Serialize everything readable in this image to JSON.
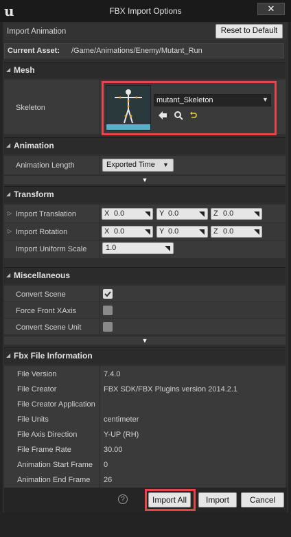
{
  "window": {
    "title": "FBX Import Options",
    "close_glyph": "✕",
    "logo_glyph": "u"
  },
  "header": {
    "import_animation_label": "Import Animation",
    "reset_label": "Reset to Default"
  },
  "asset": {
    "label": "Current Asset:",
    "path": "/Game/Animations/Enemy/Mutant_Run"
  },
  "mesh": {
    "section": "Mesh",
    "skeleton_label": "Skeleton",
    "skeleton_value": "mutant_Skeleton",
    "icons": [
      "arrow-left-icon",
      "magnifier-icon",
      "reset-arrow-icon"
    ]
  },
  "animation": {
    "section": "Animation",
    "length_label": "Animation Length",
    "length_value": "Exported Time"
  },
  "transform": {
    "section": "Transform",
    "translation_label": "Import Translation",
    "rotation_label": "Import Rotation",
    "scale_label": "Import Uniform Scale",
    "translation": {
      "x": "0.0",
      "y": "0.0",
      "z": "0.0"
    },
    "rotation": {
      "x": "0.0",
      "y": "0.0",
      "z": "0.0"
    },
    "axis_x": "X",
    "axis_y": "Y",
    "axis_z": "Z",
    "scale": "1.0"
  },
  "misc": {
    "section": "Miscellaneous",
    "convert_scene": "Convert Scene",
    "force_front": "Force Front XAxis",
    "convert_unit": "Convert Scene Unit",
    "convert_scene_checked": true,
    "force_front_checked": false,
    "convert_unit_checked": false
  },
  "info": {
    "section": "Fbx File Information",
    "rows": [
      {
        "label": "File Version",
        "value": "7.4.0"
      },
      {
        "label": "File Creator",
        "value": "FBX SDK/FBX Plugins version 2014.2.1"
      },
      {
        "label": "File Creator Application",
        "value": ""
      },
      {
        "label": "File Units",
        "value": "centimeter"
      },
      {
        "label": "File Axis Direction",
        "value": "Y-UP (RH)"
      },
      {
        "label": "File Frame Rate",
        "value": "30.00"
      },
      {
        "label": "Animation Start Frame",
        "value": "0"
      },
      {
        "label": "Animation End Frame",
        "value": "26"
      }
    ]
  },
  "footer": {
    "help": "?",
    "import_all": "Import All",
    "import": "Import",
    "cancel": "Cancel"
  },
  "colors": {
    "highlight": "#e8454a",
    "background": "#232323",
    "panel": "#3a3a3a"
  }
}
